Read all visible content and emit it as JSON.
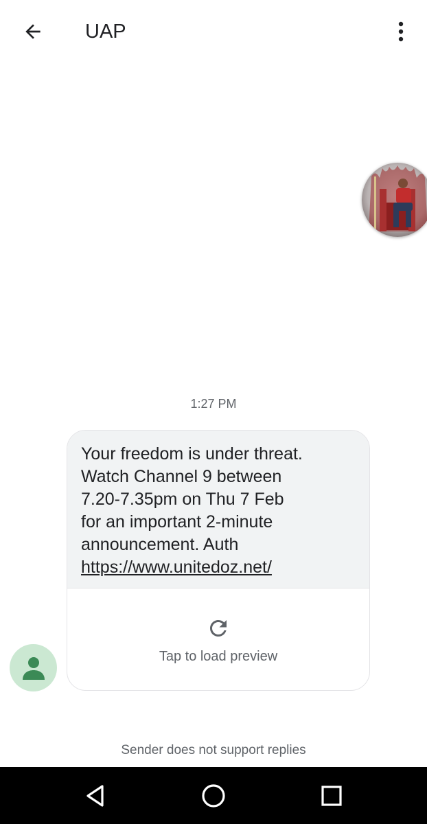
{
  "header": {
    "title": "UAP",
    "back_icon": "arrow-back-icon",
    "menu_icon": "more-vert-icon"
  },
  "contact_photo": {
    "icon": "contact-photo",
    "description_colors": [
      "#8b2a2a",
      "#c9c9c9"
    ]
  },
  "message": {
    "time": "1:27 PM",
    "lines": [
      "Your freedom is under threat.",
      "Watch Channel 9 between",
      "7.20-7.35pm on Thu 7 Feb",
      "for an important 2-minute",
      "announcement. Auth"
    ],
    "link": "https://www.unitedoz.net/",
    "preview_label": "Tap to load preview",
    "preview_icon": "refresh-icon"
  },
  "sender": {
    "avatar_icon": "person-icon",
    "avatar_bg": "#cbe8d2",
    "avatar_fg": "#3b8a56"
  },
  "footer": {
    "no_reply_text": "Sender does not support replies"
  },
  "navigation": {
    "back": "nav-back-icon",
    "home": "nav-home-icon",
    "recents": "nav-recents-icon"
  },
  "colors": {
    "bubble_bg": "#f1f3f4",
    "text": "#202124",
    "secondary_text": "#5f6368",
    "nav_bar": "#000000"
  }
}
